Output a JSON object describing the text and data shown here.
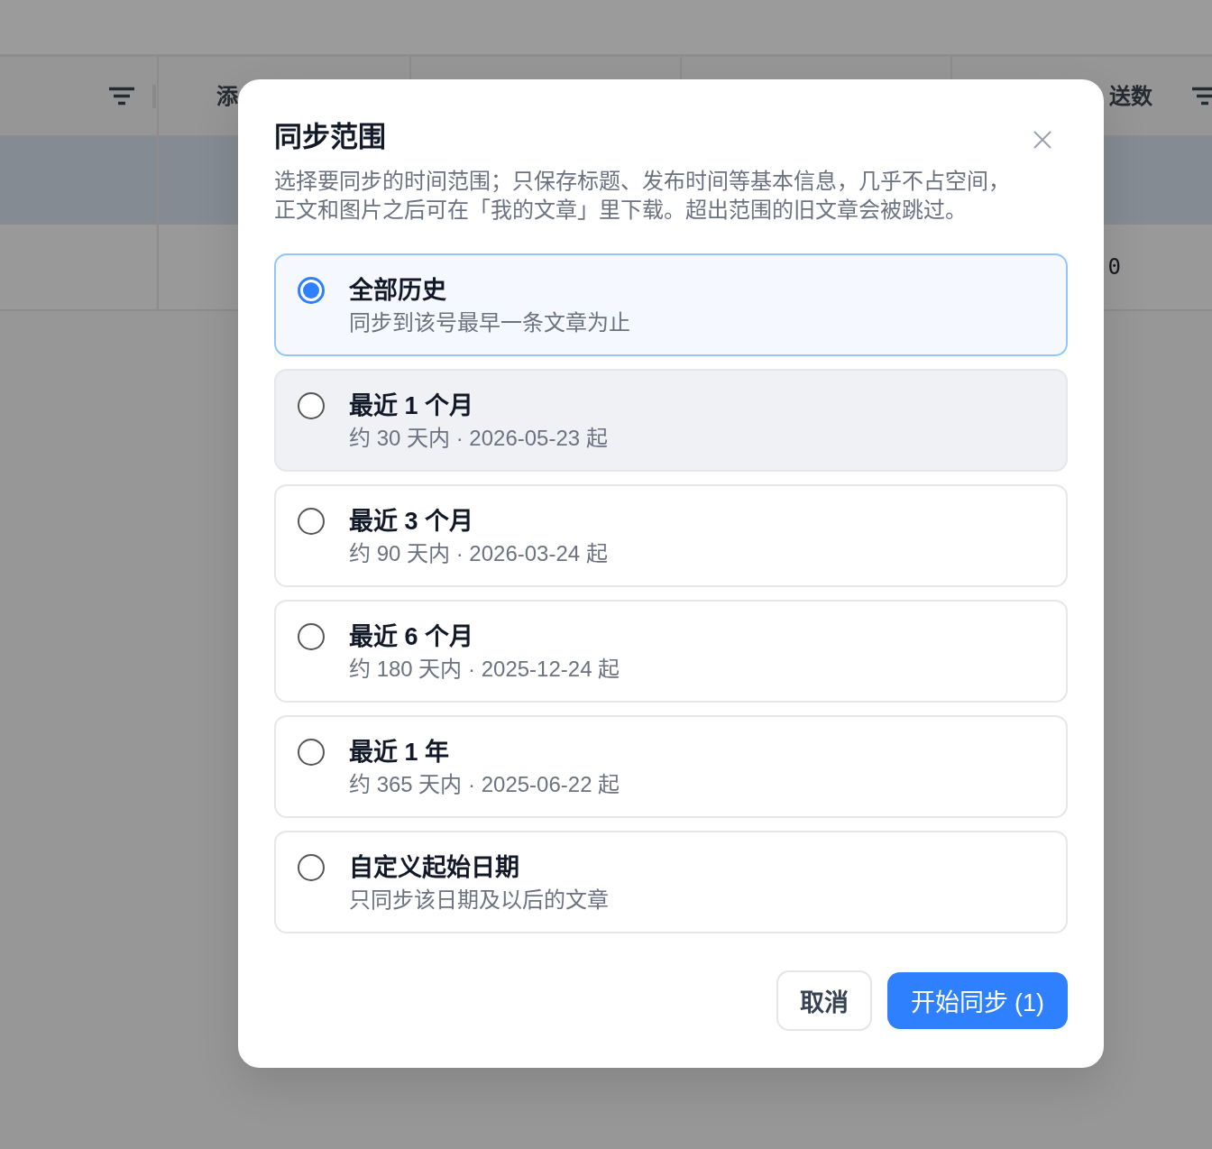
{
  "table": {
    "columns": [
      {
        "filter": true
      },
      {
        "header": "添",
        "filter": false
      },
      {
        "filter": false
      },
      {
        "filter": false
      },
      {
        "header": "送数",
        "filter": true
      }
    ],
    "rows": [
      {
        "selected": true
      },
      {
        "selected": false,
        "column_5": "0"
      }
    ]
  },
  "dialog": {
    "title": "同步范围",
    "description": "选择要同步的时间范围；只保存标题、发布时间等基本信息，几乎不占空间，正文和图片之后可在「我的文章」里下载。超出范围的旧文章会被跳过。",
    "options": [
      {
        "label": "全部历史",
        "detail": "同步到该号最早一条文章为止",
        "selected": true,
        "hovered": false
      },
      {
        "label": "最近 1 个月",
        "detail": "约 30 天内 · 2026-05-23 起",
        "selected": false,
        "hovered": true
      },
      {
        "label": "最近 3 个月",
        "detail": "约 90 天内 · 2026-03-24 起",
        "selected": false,
        "hovered": false
      },
      {
        "label": "最近 6 个月",
        "detail": "约 180 天内 · 2025-12-24 起",
        "selected": false,
        "hovered": false
      },
      {
        "label": "最近 1 年",
        "detail": "约 365 天内 · 2025-06-22 起",
        "selected": false,
        "hovered": false
      },
      {
        "label": "自定义起始日期",
        "detail": "只同步该日期及以后的文章",
        "selected": false,
        "hovered": false
      }
    ],
    "buttons": [
      {
        "label": "取消",
        "kind": "secondary"
      },
      {
        "label": "开始同步 (1)",
        "kind": "primary"
      }
    ]
  }
}
